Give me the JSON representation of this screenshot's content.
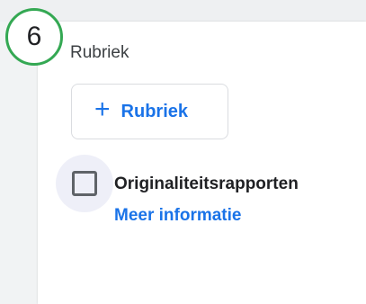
{
  "step_badge": {
    "number": "6",
    "color": "#34a853"
  },
  "section": {
    "title": "Rubriek"
  },
  "add_button": {
    "icon": "plus-icon",
    "icon_glyph": "+",
    "label": "Rubriek",
    "color": "#1a73e8"
  },
  "originality": {
    "checked": false,
    "label": "Originaliteitsrapporten",
    "link_label": "Meer informatie",
    "link_color": "#1a73e8"
  }
}
